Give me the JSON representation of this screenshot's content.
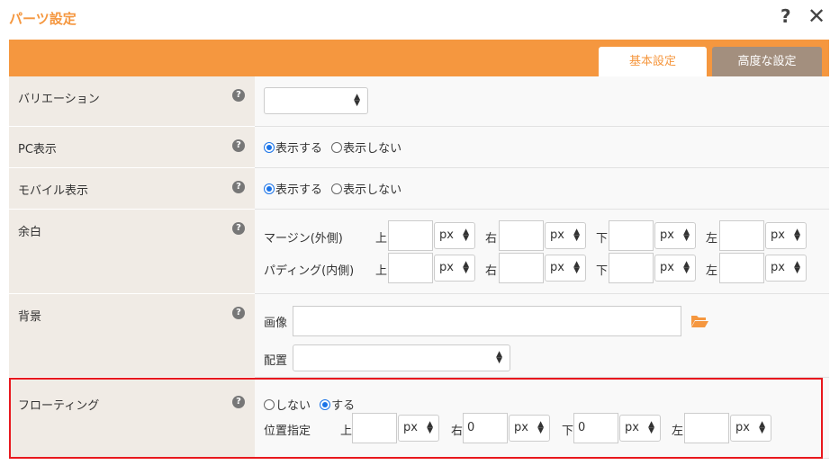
{
  "dialog": {
    "title": "パーツ設定",
    "help_label": "?",
    "close_label": "✕"
  },
  "tabs": [
    {
      "label": "基本設定",
      "active": true
    },
    {
      "label": "高度な設定",
      "active": false
    }
  ],
  "help_glyph": "?",
  "rows": {
    "variation": {
      "label": "バリエーション",
      "select_value": ""
    },
    "pc": {
      "label": "PC表示",
      "options": [
        "表示する",
        "表示しない"
      ],
      "selected": "表示する"
    },
    "mobile": {
      "label": "モバイル表示",
      "options": [
        "表示する",
        "表示しない"
      ],
      "selected": "表示する"
    },
    "margin": {
      "label": "余白",
      "margin_label": "マージン(外側)",
      "padding_label": "パディング(内側)",
      "sides": [
        "上",
        "右",
        "下",
        "左"
      ],
      "unit": "px",
      "margin_values": [
        "",
        "",
        "",
        ""
      ],
      "padding_values": [
        "",
        "",
        "",
        ""
      ]
    },
    "background": {
      "label": "背景",
      "image_label": "画像",
      "image_value": "",
      "position_label": "配置",
      "position_value": ""
    },
    "floating": {
      "label": "フローティング",
      "options": [
        "しない",
        "する"
      ],
      "selected": "する",
      "position_label": "位置指定",
      "sides": [
        "上",
        "右",
        "下",
        "左"
      ],
      "unit": "px",
      "values": [
        "",
        "0",
        "0",
        ""
      ]
    }
  },
  "colors": {
    "accent": "#f5973f",
    "tab_inactive": "#a38f7e",
    "label_bg": "#f0ebe5",
    "highlight": "#e8181e",
    "radio_checked": "#1a73e8",
    "folder": "#f5973f"
  },
  "icons": [
    "help-icon",
    "close-icon",
    "question-circle-icon",
    "select-arrows-icon",
    "folder-open-icon"
  ]
}
